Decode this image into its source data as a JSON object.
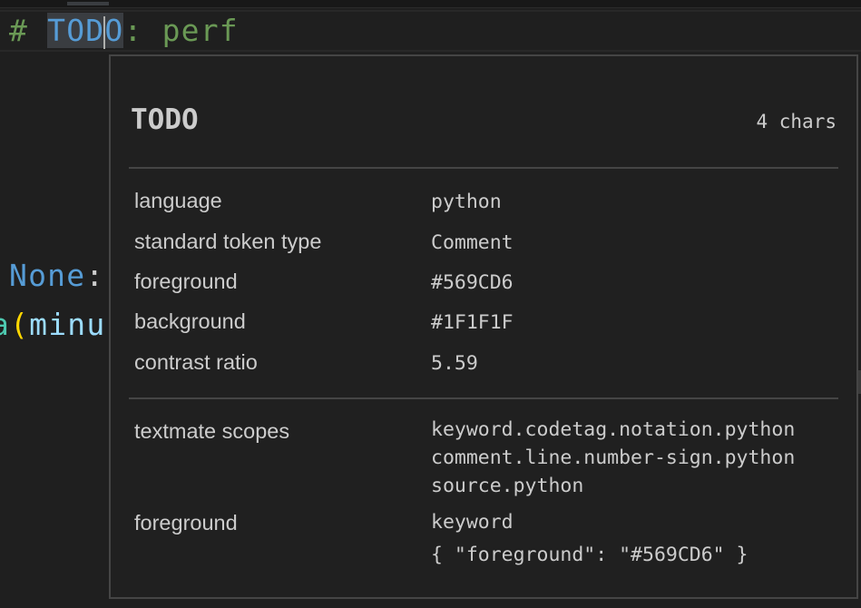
{
  "editor": {
    "line1": {
      "hash": "#",
      "token": "TODO",
      "token_before_cursor": "TOD",
      "token_after_cursor": "O",
      "rest": ": perf"
    },
    "line2": {
      "keyword": "None",
      "punct": ":"
    },
    "line3": {
      "func_tail": "a",
      "paren": "(",
      "param": "minu"
    }
  },
  "inspector": {
    "title": "TODO",
    "char_count": "4 chars",
    "rows": {
      "language": {
        "label": "language",
        "value": "python"
      },
      "token_type": {
        "label": "standard token type",
        "value": "Comment"
      },
      "foreground": {
        "label": "foreground",
        "value": "#569CD6"
      },
      "background": {
        "label": "background",
        "value": "#1F1F1F"
      },
      "contrast": {
        "label": "contrast ratio",
        "value": "5.59"
      }
    },
    "textmate": {
      "label": "textmate scopes",
      "scopes": [
        "keyword.codetag.notation.python",
        "comment.line.number-sign.python",
        "source.python"
      ]
    },
    "theme_rule": {
      "label": "foreground",
      "selector": "keyword",
      "settings": "{ \"foreground\": \"#569CD6\" }"
    }
  },
  "colors": {
    "editor_background": "#1F1F1F",
    "keyword": "#569CD6",
    "comment": "#6A9955",
    "function": "#4EC9B0",
    "bracket": "#FFD700",
    "parameter": "#9CDCFE",
    "hover_border": "#454545"
  }
}
